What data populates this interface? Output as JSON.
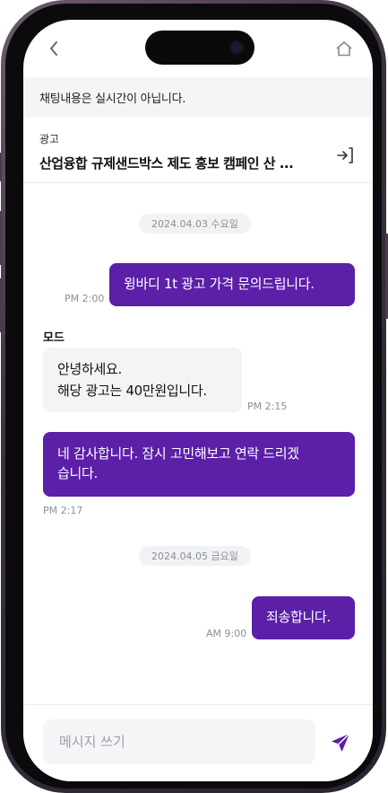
{
  "nav": {
    "back_icon": "chevron-left-icon",
    "home_icon": "home-icon"
  },
  "notice": {
    "text": "채팅내용은 실시간이 아닙니다."
  },
  "ad": {
    "label": "광고",
    "title": "산업융합 규제샌드박스 제도 홍보 캠페인 산 ...",
    "enter_icon": "enter-icon"
  },
  "chat": {
    "date1": "2024.04.03 수요일",
    "msg1": {
      "text": "윙바디 1t 광고 가격 문의드립니다.",
      "time": "PM 2:00"
    },
    "sender": "모드",
    "msg2": {
      "line1": "안녕하세요.",
      "line2": "해당 광고는 40만원입니다.",
      "time": "PM 2:15"
    },
    "msg3": {
      "line1": "네 감사합니다. 잠시 고민해보고 연락 드리겠",
      "line2": "습니다.",
      "time": "PM 2:17"
    },
    "date2": "2024.04.05 금요일",
    "msg4": {
      "text": "죄송합니다.",
      "time": "AM 9:00"
    }
  },
  "input": {
    "placeholder": "메시지 쓰기",
    "value": ""
  },
  "colors": {
    "accent": "#5b1fa8",
    "bubble_other": "#f4f4f6",
    "chip": "#f1f2f4"
  }
}
